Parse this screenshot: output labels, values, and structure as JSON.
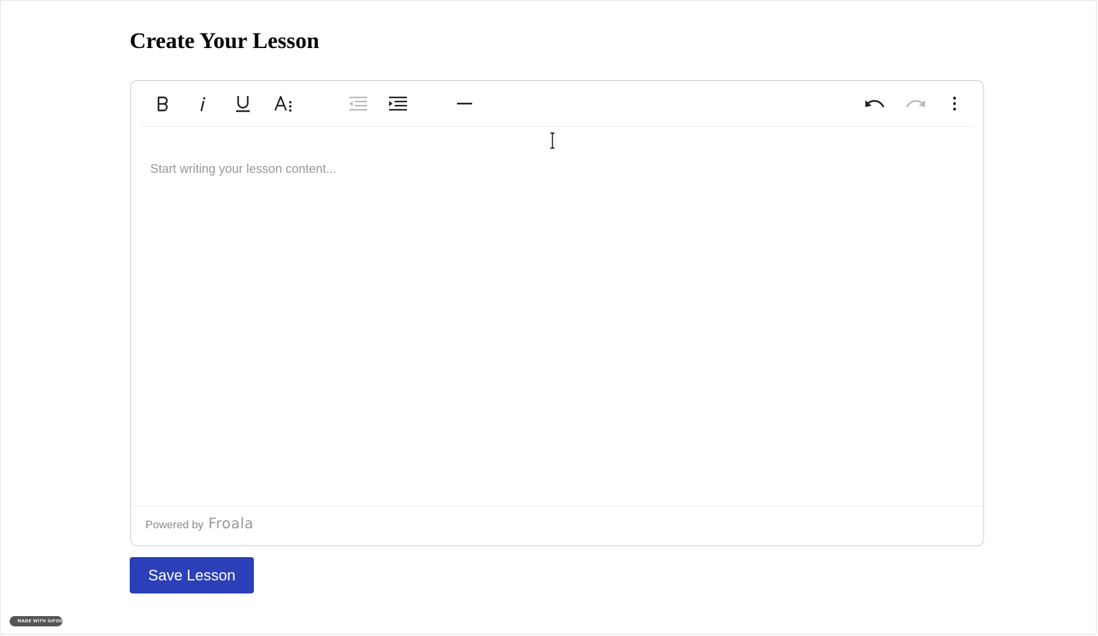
{
  "page": {
    "title": "Create Your Lesson"
  },
  "editor": {
    "toolbar": {
      "buttons": [
        {
          "name": "bold",
          "icon": "bold-icon",
          "enabled": true
        },
        {
          "name": "italic",
          "icon": "italic-icon",
          "enabled": true
        },
        {
          "name": "underline",
          "icon": "underline-icon",
          "enabled": true
        },
        {
          "name": "more-text",
          "icon": "text-format-more-icon",
          "enabled": true
        },
        {
          "name": "outdent",
          "icon": "outdent-icon",
          "enabled": false
        },
        {
          "name": "indent",
          "icon": "indent-icon",
          "enabled": true
        },
        {
          "name": "horizontal-line",
          "icon": "horizontal-line-icon",
          "enabled": true
        },
        {
          "name": "undo",
          "icon": "undo-icon",
          "enabled": true
        },
        {
          "name": "redo",
          "icon": "redo-icon",
          "enabled": false
        },
        {
          "name": "more-misc",
          "icon": "vertical-dots-icon",
          "enabled": true
        }
      ]
    },
    "content": {
      "value": "",
      "placeholder": "Start writing your lesson content..."
    },
    "footer": {
      "powered_by": "Powered by",
      "brand": "Froala"
    }
  },
  "actions": {
    "save_label": "Save Lesson"
  },
  "watermark": {
    "text": "MADE WITH GIFOX"
  },
  "colors": {
    "primary_button": "#2b40b8",
    "icon_enabled": "#222222",
    "icon_disabled": "#bbbbbb",
    "border": "#cccccc"
  }
}
